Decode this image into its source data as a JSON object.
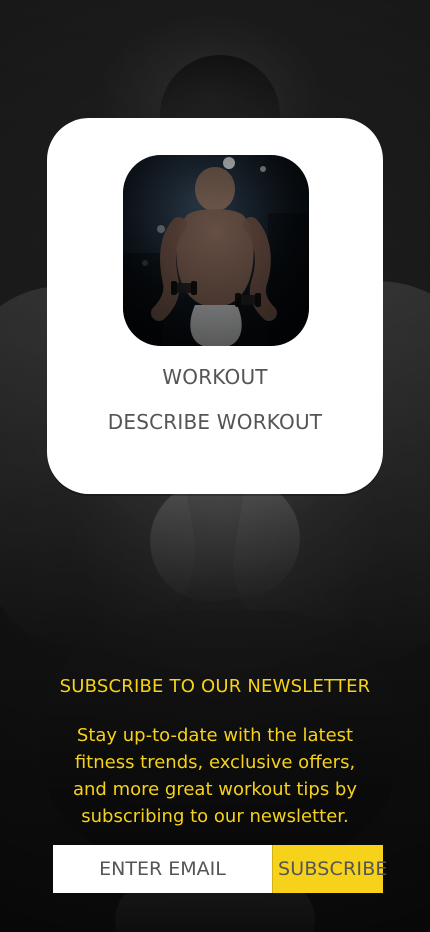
{
  "card": {
    "title": "WORKOUT",
    "description": "DESCRIBE WORKOUT",
    "image_icon": "workout-photo"
  },
  "newsletter": {
    "title": "SUBSCRIBE TO OUR NEWSLETTER",
    "body": "Stay up-to-date with the latest fitness trends, exclusive offers, and more great workout tips by subscribing to our newsletter.",
    "email_placeholder": "ENTER EMAIL",
    "subscribe_label": "SUBSCRIBE"
  },
  "colors": {
    "accent_yellow": "#f6d21a",
    "card_bg": "#ffffff",
    "text_gray": "#555555"
  }
}
